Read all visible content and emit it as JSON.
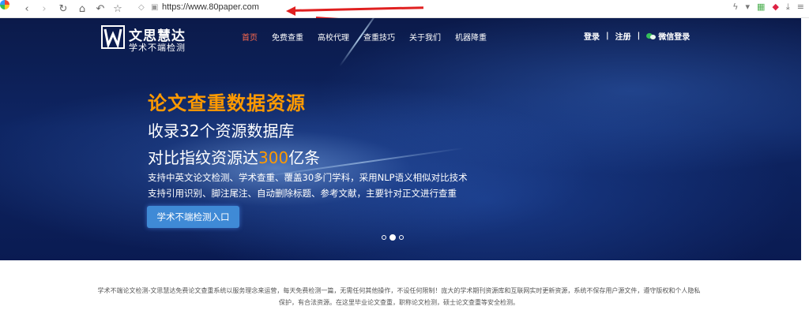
{
  "browser": {
    "url": "https://www.80paper.com",
    "nav_icons": [
      "back-icon",
      "forward-icon",
      "reload-icon",
      "home-icon",
      "undo-icon",
      "star-icon"
    ],
    "right_icons": [
      "flash-icon",
      "dropdown-icon",
      "apps-icon",
      "extension-icon",
      "download-icon",
      "menu-icon"
    ]
  },
  "site": {
    "logo_name": "文思慧达",
    "logo_slogan": "学术不端检测",
    "nav": [
      "首页",
      "免费查重",
      "高校代理",
      "查重技巧",
      "关于我们",
      "机器降重"
    ],
    "nav_active_index": 0,
    "login": "登录",
    "separator": "|",
    "register": "注册",
    "wechat_login": "微信登录"
  },
  "hero": {
    "title": "论文查重数据资源",
    "line2": "收录32个资源数据库",
    "line3_prefix": "对比指纹资源达",
    "line3_highlight": "300",
    "line3_suffix": "亿条",
    "desc1": "支持中英文论文检测、学术查重、覆盖30多门学科，采用NLP语义相似对比技术",
    "desc2": "支持引用识别、脚注尾注、自动删除标题、参考文献，主要针对正文进行查重",
    "cta_label": "学术不端检测入口",
    "slide_count": 3,
    "slide_active": 1
  },
  "footer": {
    "text": "学术不端论文检测-文思慧达免费论文查重系统以服务理念来运营，每天免费检测一篇，无需任何其他操作，不设任何限制！庞大的学术期刊资源库和互联网实时更新资源，系统不保存用户源文件，遵守版权和个人隐私保护，有合法资源。在这里毕业论文查重，职称论文检测，硕士论文查重等安全检测。"
  },
  "colors": {
    "accent_orange": "#ff9a00",
    "nav_active": "#ff6a4d",
    "cta_blue": "#3f8ad6",
    "annotation_red": "#e02020",
    "wechat_green": "#35c05a"
  }
}
